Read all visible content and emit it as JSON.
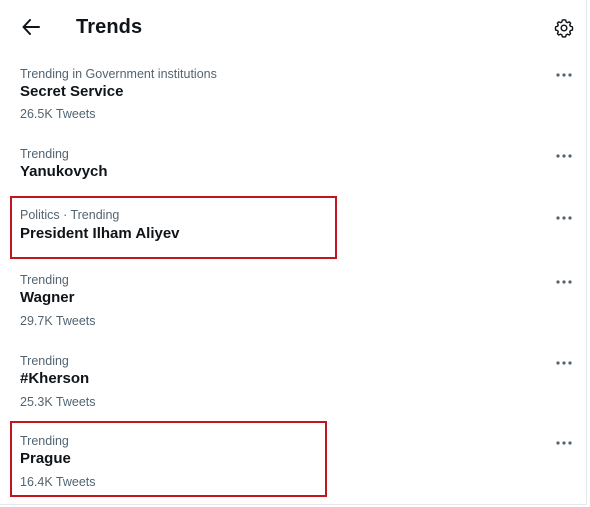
{
  "header": {
    "title": "Trends",
    "back_icon": "arrow-left-icon",
    "settings_icon": "gear-icon"
  },
  "trends": [
    {
      "context": "Trending in Government institutions",
      "name": "Secret Service",
      "count": "26.5K Tweets"
    },
    {
      "context": "Trending",
      "name": "Yanukovych",
      "count": ""
    },
    {
      "context": "Politics · Trending",
      "name": "President Ilham Aliyev",
      "count": ""
    },
    {
      "context": "Trending",
      "name": "Wagner",
      "count": "29.7K Tweets"
    },
    {
      "context": "Trending",
      "name": "#Kherson",
      "count": "25.3K Tweets"
    },
    {
      "context": "Trending",
      "name": "Prague",
      "count": "16.4K Tweets"
    }
  ],
  "more_icon": "more-horizontal-icon",
  "annotation_color": "#c0161f"
}
